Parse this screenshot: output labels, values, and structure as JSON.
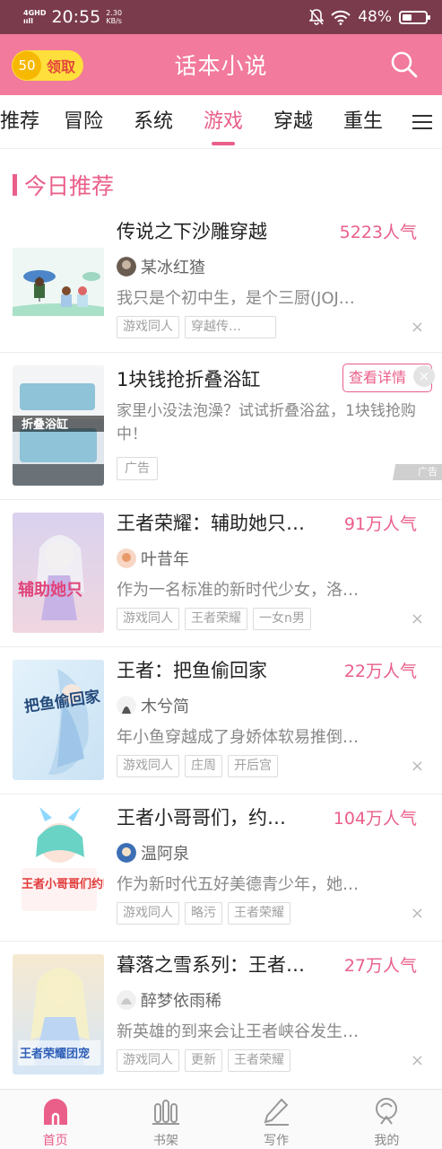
{
  "status_bar": {
    "network": "4GHD",
    "signal": "ııll",
    "time": "20:55",
    "speed_value": "2.30",
    "speed_unit": "KB/s",
    "battery": "48%"
  },
  "header": {
    "coin_amount": "50",
    "coin_label": "领取",
    "title": "话本小说"
  },
  "tabs": [
    "推荐",
    "冒险",
    "系统",
    "游戏",
    "穿越",
    "重生"
  ],
  "active_tab": "游戏",
  "section": {
    "title": "今日推荐"
  },
  "books": [
    {
      "title": "传说之下沙雕穿越",
      "popularity": "5223人气",
      "author": "某冰红猹",
      "desc": "我只是个初中生，是个三厨(JOJ…",
      "tags": [
        "游戏同人",
        "穿越传…"
      ]
    },
    {
      "title": "王者荣耀：辅助她只…",
      "popularity": "91万人气",
      "author": "叶昔年",
      "desc": "作为一名标准的新时代少女，洛…",
      "tags": [
        "游戏同人",
        "王者荣耀",
        "一女n男"
      ]
    },
    {
      "title": "王者：把鱼偷回家",
      "popularity": "22万人气",
      "author": "木兮简",
      "desc": "年小鱼穿越成了身娇体软易推倒…",
      "tags": [
        "游戏同人",
        "庄周",
        "开后宫"
      ]
    },
    {
      "title": "王者小哥哥们，约…",
      "popularity": "104万人气",
      "author": "温阿泉",
      "desc": "作为新时代五好美德青少年，她…",
      "tags": [
        "游戏同人",
        "略污",
        "王者荣耀"
      ]
    },
    {
      "title": "暮落之雪系列：王者…",
      "popularity": "27万人气",
      "author": "醉梦依雨稀",
      "desc": "新英雄的到来会让王者峡谷发生…",
      "tags": [
        "游戏同人",
        "更新",
        "王者荣耀"
      ]
    }
  ],
  "ad": {
    "title": "1块钱抢折叠浴缸",
    "button": "查看详情",
    "desc": "家里小没法泡澡？试试折叠浴盆，1块钱抢购中！",
    "tag": "广告",
    "badge": "广告",
    "cover_text": "折叠浴缸"
  },
  "covers": {
    "book2": "辅助她只",
    "book3": "把鱼偷回家",
    "book4": "王者小哥哥们约吗？",
    "book5": "王者荣耀团宠"
  },
  "close_glyph": "×",
  "bottom_nav": [
    {
      "label": "首页",
      "icon": "home-icon",
      "active": true
    },
    {
      "label": "书架",
      "icon": "bookshelf-icon",
      "active": false
    },
    {
      "label": "写作",
      "icon": "pen-icon",
      "active": false
    },
    {
      "label": "我的",
      "icon": "profile-icon",
      "active": false
    }
  ],
  "colors": {
    "accent": "#ea5f8a",
    "header_bg": "#f27a9c",
    "status_bg": "#7a3b4c",
    "coin_bg": "#ffdf3b"
  }
}
